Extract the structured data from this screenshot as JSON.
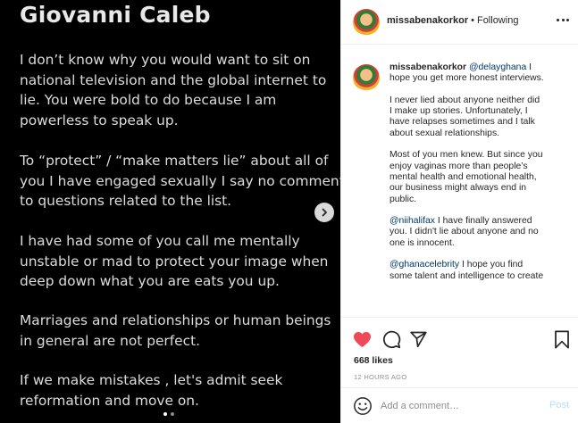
{
  "media": {
    "title": "Giovanni Caleb",
    "paragraphs": [
      [
        "I don’t know why you would want to sit on",
        "national television and the global internet to",
        "lie. You were bold to do because I am",
        "powerless to speak up."
      ],
      [
        "To “protect” / “make matters lie” about all of",
        "you I have engaged sexually I say no comment",
        "to questions related to the list."
      ],
      [
        "I have had some of you call me mentally",
        "unstable or mad to protect your image when",
        "deep down what you are eats you up."
      ],
      [
        "Marriages and relationships or human beings",
        "in general are not perfect."
      ],
      [
        "If we make mistakes , let's admit seek",
        "reformation and move on."
      ]
    ],
    "next_icon": "chevron-right-icon",
    "carousel": {
      "count": 2,
      "active": 0
    }
  },
  "header": {
    "username": "missabenakorkor",
    "separator": "•",
    "follow_status": "Following",
    "more_icon": "more-horizontal-icon"
  },
  "caption": {
    "username": "missabenakorkor",
    "blocks": [
      [
        [
          {
            "t": "@delayghana",
            "m": true
          },
          {
            "t": " I"
          }
        ],
        [
          {
            "t": "hope you get more honest interviews."
          }
        ]
      ],
      [
        [
          {
            "t": "I never lied about anyone neither did"
          }
        ],
        [
          {
            "t": "I make up stories. Unfortunately, I"
          }
        ],
        [
          {
            "t": "have relapses sometimes and I talk"
          }
        ],
        [
          {
            "t": "about sexual relationships."
          }
        ]
      ],
      [
        [
          {
            "t": "Most of you men knew. But since you"
          }
        ],
        [
          {
            "t": "enjoy vaginas more than people’s"
          }
        ],
        [
          {
            "t": "mental health and emotional health,"
          }
        ],
        [
          {
            "t": "our business might always end in"
          }
        ],
        [
          {
            "t": "public."
          }
        ]
      ],
      [
        [
          {
            "t": "@niihalifax",
            "m": true
          },
          {
            "t": " I have finally answered"
          }
        ],
        [
          {
            "t": "you. I didn't lie about anyone and no"
          }
        ],
        [
          {
            "t": "one is innocent."
          }
        ]
      ],
      [
        [
          {
            "t": "@ghanacelebrity",
            "m": true
          },
          {
            "t": " I hope you find"
          }
        ],
        [
          {
            "t": "some talent and intelligence to create"
          }
        ]
      ]
    ]
  },
  "actions": {
    "like_icon": "heart-icon",
    "comment_icon": "comment-icon",
    "share_icon": "paper-plane-icon",
    "save_icon": "bookmark-icon",
    "likes_text": "668 likes",
    "timestamp": "12 HOURS AGO"
  },
  "comment_box": {
    "emoji_icon": "smiley-icon",
    "placeholder": "Add a comment…",
    "post_label": "Post"
  },
  "colors": {
    "like": "#ed4956",
    "mention": "#00376b",
    "post_disabled": "#b2dffc",
    "media_background": "#000000"
  }
}
